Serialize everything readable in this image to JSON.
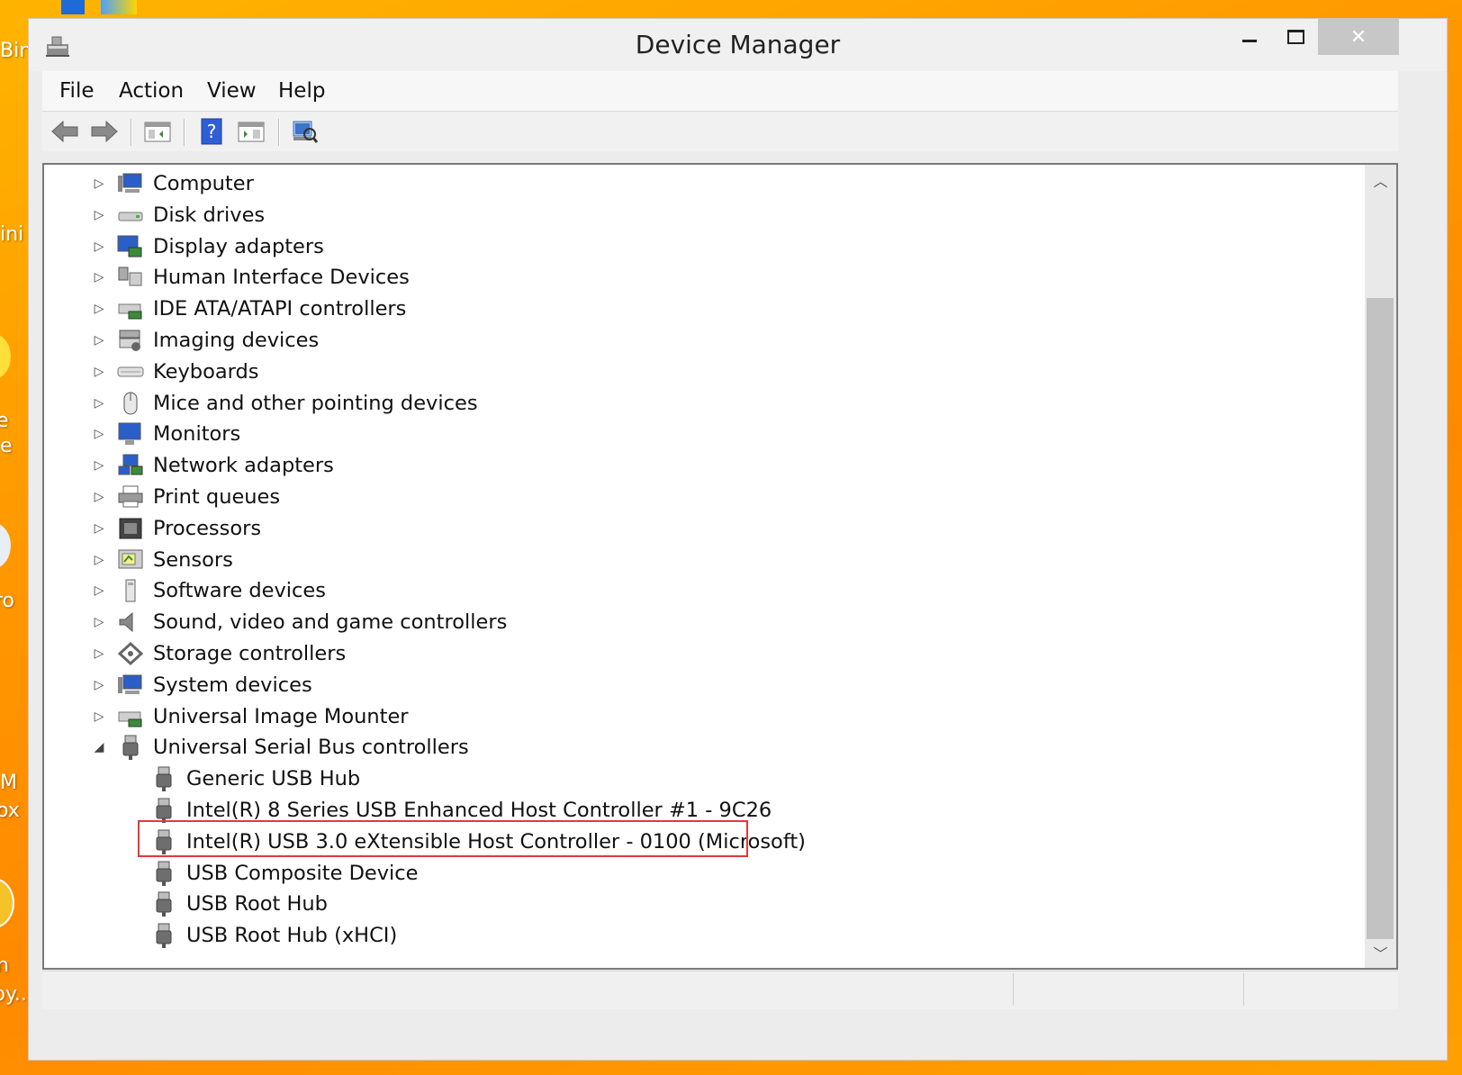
{
  "desktop": {
    "labels": [
      "Bin",
      "ini",
      "e",
      "e",
      "ro",
      "M",
      "ox",
      "n",
      "py..."
    ]
  },
  "window": {
    "title": "Device Manager",
    "close_glyph": "✕"
  },
  "menu": {
    "items": [
      "File",
      "Action",
      "View",
      "Help"
    ]
  },
  "toolbar": {
    "icons": [
      "back-arrow-icon",
      "forward-arrow-icon",
      "show-hide-console-tree-icon",
      "help-icon",
      "properties-icon",
      "scan-hardware-changes-icon"
    ]
  },
  "tree": {
    "categories": [
      {
        "label": "Computer",
        "icon": "computer-icon",
        "expander": "▷"
      },
      {
        "label": "Disk drives",
        "icon": "disk-drive-icon",
        "expander": "▷"
      },
      {
        "label": "Display adapters",
        "icon": "display-adapter-icon",
        "expander": "▷"
      },
      {
        "label": "Human Interface Devices",
        "icon": "hid-icon",
        "expander": "▷"
      },
      {
        "label": "IDE ATA/ATAPI controllers",
        "icon": "ide-controller-icon",
        "expander": "▷"
      },
      {
        "label": "Imaging devices",
        "icon": "imaging-device-icon",
        "expander": "▷"
      },
      {
        "label": "Keyboards",
        "icon": "keyboard-icon",
        "expander": "▷"
      },
      {
        "label": "Mice and other pointing devices",
        "icon": "mouse-icon",
        "expander": "▷"
      },
      {
        "label": "Monitors",
        "icon": "monitor-icon",
        "expander": "▷"
      },
      {
        "label": "Network adapters",
        "icon": "network-adapter-icon",
        "expander": "▷"
      },
      {
        "label": "Print queues",
        "icon": "printer-icon",
        "expander": "▷"
      },
      {
        "label": "Processors",
        "icon": "processor-icon",
        "expander": "▷"
      },
      {
        "label": "Sensors",
        "icon": "sensor-icon",
        "expander": "▷"
      },
      {
        "label": "Software devices",
        "icon": "software-device-icon",
        "expander": "▷"
      },
      {
        "label": "Sound, video and game controllers",
        "icon": "speaker-icon",
        "expander": "▷"
      },
      {
        "label": "Storage controllers",
        "icon": "storage-controller-icon",
        "expander": "▷"
      },
      {
        "label": "System devices",
        "icon": "system-device-icon",
        "expander": "▷"
      },
      {
        "label": "Universal Image Mounter",
        "icon": "image-mounter-icon",
        "expander": "▷"
      },
      {
        "label": "Universal Serial Bus controllers",
        "icon": "usb-plug-icon",
        "expander": "◢"
      }
    ],
    "usb_children": [
      {
        "label": "Generic USB Hub",
        "highlighted": false
      },
      {
        "label": "Intel(R) 8 Series USB Enhanced Host Controller #1 - 9C26",
        "highlighted": false
      },
      {
        "label": "Intel(R) USB 3.0 eXtensible Host Controller - 0100 (Microsoft)",
        "highlighted": true
      },
      {
        "label": "USB Composite Device",
        "highlighted": false
      },
      {
        "label": "USB Root Hub",
        "highlighted": false
      },
      {
        "label": "USB Root Hub (xHCI)",
        "highlighted": false
      }
    ]
  },
  "scrollbar": {
    "up_glyph": "︿",
    "down_glyph": "﹀"
  },
  "colors": {
    "highlight_border": "#e0393e",
    "desktop_background": "#ff9800"
  }
}
